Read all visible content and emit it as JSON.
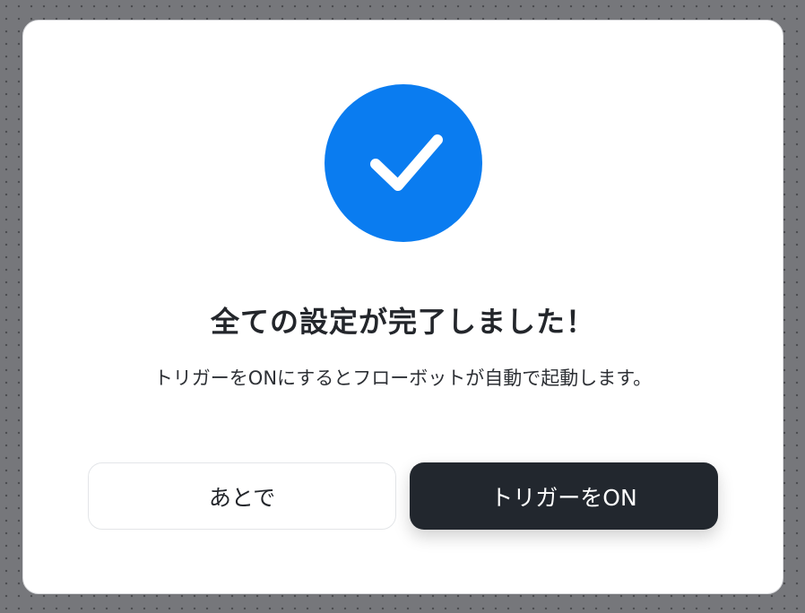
{
  "colors": {
    "accent": "#0a7cf0",
    "primary_button": "#22272e",
    "overlay": "#76777b"
  },
  "icons": {
    "status": "checkmark-icon"
  },
  "dialog": {
    "title": "全ての設定が完了しました！",
    "message": "トリガーをONにするとフローボットが自動で起動します。",
    "later_button_label": "あとで",
    "trigger_on_button_label": "トリガーをON"
  }
}
